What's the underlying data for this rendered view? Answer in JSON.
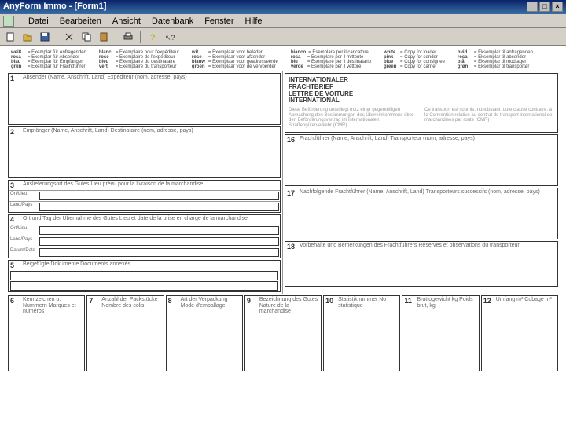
{
  "title": "AnyForm Immo - [Form1]",
  "menu": {
    "datei": "Datei",
    "bearbeiten": "Bearbeiten",
    "ansicht": "Ansicht",
    "datenbank": "Datenbank",
    "fenster": "Fenster",
    "hilfe": "Hilfe"
  },
  "legend": [
    [
      {
        "k": "weiß",
        "v": "= Exemplar für Anfragenden"
      },
      {
        "k": "rosa",
        "v": "= Exemplar für Absender"
      },
      {
        "k": "blau",
        "v": "= Exemplar für Empfänger"
      },
      {
        "k": "grün",
        "v": "= Exemplar für Frachtführer"
      }
    ],
    [
      {
        "k": "blanc",
        "v": "= Exemplaire pour l'expéditeur"
      },
      {
        "k": "rose",
        "v": "= Exemplaire de l'expéditeur"
      },
      {
        "k": "bleu",
        "v": "= Exemplaire du destinataire"
      },
      {
        "k": "vert",
        "v": "= Exemplaire du transporteur"
      }
    ],
    [
      {
        "k": "wit",
        "v": "= Exemplaar voor belader"
      },
      {
        "k": "rose",
        "v": "= Exemplaar voor afzender"
      },
      {
        "k": "blauw",
        "v": "= Exemplaar voor geadresseerde"
      },
      {
        "k": "groen",
        "v": "= Exemplaar voor de vervoerder"
      }
    ],
    [
      {
        "k": "bianco",
        "v": "= Esemplare per il caricatore"
      },
      {
        "k": "rosa",
        "v": "= Esemplare per il mittente"
      },
      {
        "k": "blu",
        "v": "= Esemplare per il destinatario"
      },
      {
        "k": "verde",
        "v": "= Esemplare per il vettore"
      }
    ],
    [
      {
        "k": "white",
        "v": "= Copy for loader"
      },
      {
        "k": "pink",
        "v": "= Copy for sender"
      },
      {
        "k": "blue",
        "v": "= Copy for consignee"
      },
      {
        "k": "green",
        "v": "= Copy for carrier"
      }
    ],
    [
      {
        "k": "hvid",
        "v": "= Eksemplar til anfragenden"
      },
      {
        "k": "rosa",
        "v": "= Eksemplar til absender"
      },
      {
        "k": "blå",
        "v": "= Eksemplar til modtager"
      },
      {
        "k": "grøn",
        "v": "= Eksemplar til transportør"
      }
    ]
  ],
  "tb": {
    "title1": "INTERNATIONALER",
    "title2": "FRACHTBRIEF",
    "title3": "LETTRE DE VOITURE",
    "title4": "INTERNATIONAL",
    "noteL": "Diese Beförderung unterliegt trotz einer gegenteiligen Abmachung den Bestimmungen des Übereinkommens über den Beförderungsvertrag im internationalen Straßengüterverkehr (CMR)",
    "noteR": "Ce transport est soumis, nonobstant toute clause contraire, à la Convention relative au contrat de transport international de marchandises par route (CMR)"
  },
  "boxes": {
    "1": "Absender (Name, Anschrift, Land)\nExpéditeur (nom, adresse, pays)",
    "2": "Empfänger (Name, Anschrift, Land)\nDestinataire (nom, adresse, pays)",
    "3": "Auslieferungsort des Gutes\nLieu prévu pour la livraison de la marchandise",
    "4": "Ort und Tag der Übernahme des Gutes\nLieu et date de la prise en charge de la marchandise",
    "5": "Beigefügte Dokumente\nDocuments annexés",
    "6": "Kennzeichen u. Nummern\nMarques et numéros",
    "7": "Anzahl der Packstücke\nNombre des colis",
    "8": "Art der Verpackung\nMode d'emballage",
    "9": "Bezeichnung des Gutes\nNature de la marchandise",
    "10": "Statistiknummer\nNo statistique",
    "11": "Bruttogewicht kg\nPoids brut, kg",
    "12": "Umfang m³\nCubage m³",
    "16": "Frachtführer (Name, Anschrift, Land)\nTransporteur (nom, adresse, pays)",
    "17": "Nachfolgende Frachtführer (Name, Anschrift, Land)\nTransporteurs successifs (nom, adresse, pays)",
    "18": "Vorbehalte und Bemerkungen des Frachtführers\nRéserves et observations du transporteur"
  },
  "rl": {
    "ort": "Ort/Lieu",
    "ldatum": "Land/Pays",
    "datum": "Datum/Date"
  }
}
